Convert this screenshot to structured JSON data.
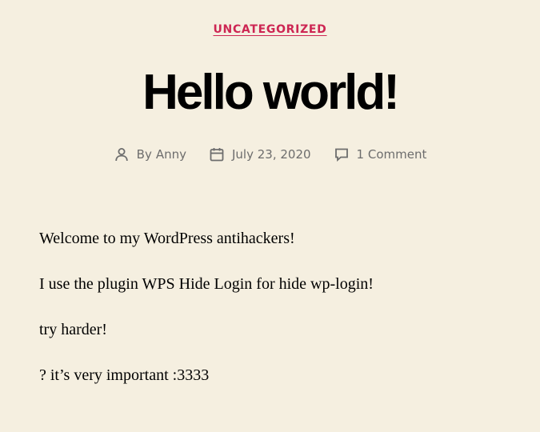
{
  "post": {
    "category": "UNCATEGORIZED",
    "title": "Hello world!",
    "meta": {
      "by_prefix": "By",
      "author": "Anny",
      "date": "July 23, 2020",
      "comments": "1 Comment"
    },
    "content": {
      "paragraphs": [
        "Welcome to my WordPress antihackers!",
        "I use the plugin WPS Hide Login for hide wp-login!",
        "try harder!",
        "? it’s very important :3333"
      ]
    }
  },
  "colors": {
    "background": "#f5efe0",
    "accent": "#cd2653",
    "meta_text": "#6d6d6d"
  },
  "icons": {
    "author": "person-icon",
    "date": "calendar-icon",
    "comments": "comment-bubble-icon"
  }
}
